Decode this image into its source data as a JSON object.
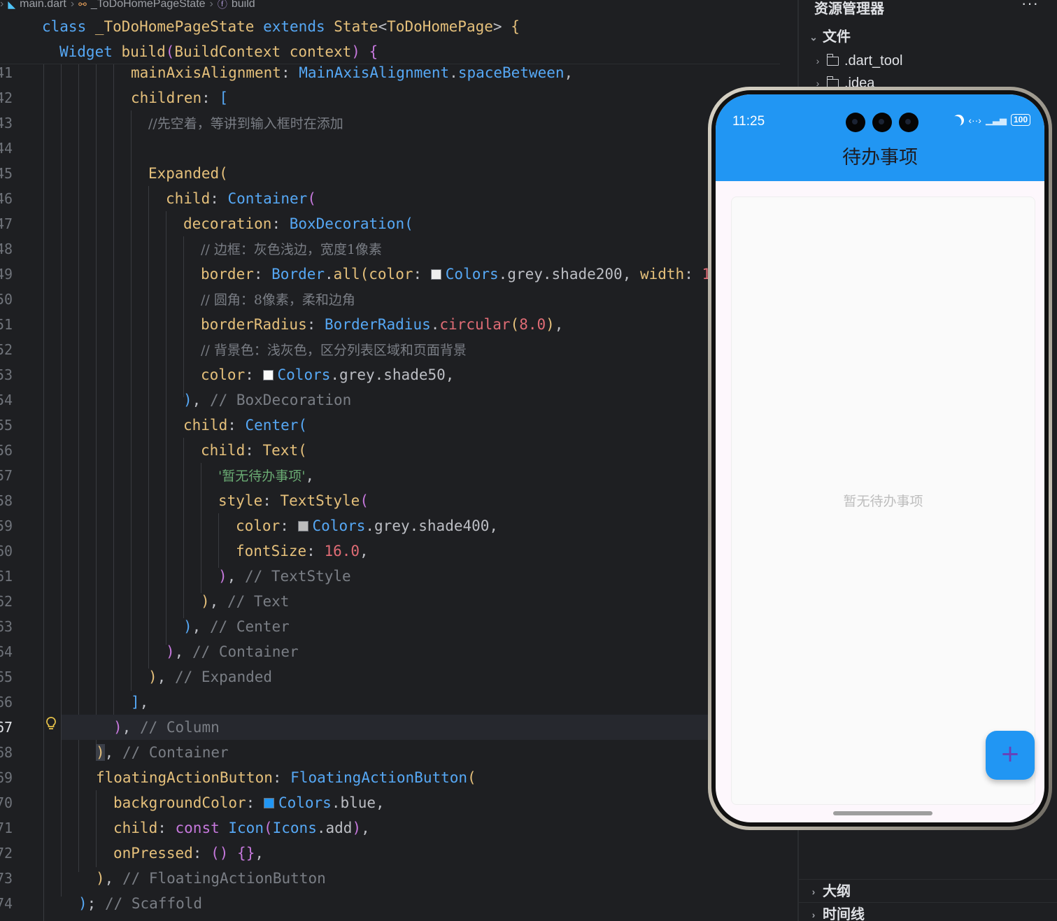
{
  "breadcrumb": {
    "file": "main.dart",
    "class": "_ToDoHomePageState",
    "method": "build"
  },
  "sticky": [
    {
      "kw": "class",
      "name": "_ToDoHomePageState",
      "ext": "extends",
      "base": "State",
      "generic": "ToDoHomePage",
      "brace": "{"
    },
    {
      "ret": "Widget",
      "fn": "build",
      "ptype": "BuildContext",
      "pname": "context",
      "brace": "{"
    }
  ],
  "line_numbers": [
    "41",
    "42",
    "43",
    "44",
    "45",
    "46",
    "47",
    "48",
    "49",
    "50",
    "51",
    "52",
    "53",
    "54",
    "55",
    "56",
    "57",
    "58",
    "59",
    "60",
    "61",
    "62",
    "63",
    "64",
    "65",
    "66",
    "67",
    "68",
    "69",
    "70",
    "71",
    "72",
    "73",
    "74"
  ],
  "code": {
    "l41": {
      "prop": "mainAxisAlignment",
      "ty": "MainAxisAlignment",
      "val": "spaceBetween"
    },
    "l42": {
      "prop": "children",
      "open": "["
    },
    "l43": {
      "comment": "//先空着，等讲到输入框时在添加"
    },
    "l45": {
      "ty": "Expanded",
      "open": "("
    },
    "l46": {
      "prop": "child",
      "ty": "Container",
      "open": "("
    },
    "l47": {
      "prop": "decoration",
      "ty": "BoxDecoration",
      "open": "("
    },
    "l48": {
      "comment": "// 边框：灰色浅边，宽度1像素"
    },
    "l49": {
      "prop": "border",
      "ty": "Border",
      "fn": "all",
      "arg": "color",
      "swatch": "#eeeeee",
      "colors": "Colors",
      "grey": "grey",
      "shade": "shade200",
      "arg2": "width",
      "tail": "1"
    },
    "l50": {
      "comment": "// 圆角：8像素，柔和边角"
    },
    "l51": {
      "prop": "borderRadius",
      "ty": "BorderRadius",
      "fn": "circular",
      "num": "8.0"
    },
    "l52": {
      "comment": "// 背景色：浅灰色，区分列表区域和页面背景"
    },
    "l53": {
      "prop": "color",
      "swatch": "#fafafa",
      "colors": "Colors",
      "grey": "grey",
      "shade": "shade50"
    },
    "l54": {
      "comment": "// BoxDecoration"
    },
    "l55": {
      "prop": "child",
      "ty": "Center",
      "open": "("
    },
    "l56": {
      "prop": "child",
      "ty": "Text",
      "open": "("
    },
    "l57": {
      "str": "'暂无待办事项'"
    },
    "l58": {
      "prop": "style",
      "ty": "TextStyle",
      "open": "("
    },
    "l59": {
      "prop": "color",
      "swatch": "#bdbdbd",
      "colors": "Colors",
      "grey": "grey",
      "shade": "shade400"
    },
    "l60": {
      "prop": "fontSize",
      "num": "16.0"
    },
    "l61": {
      "comment": "// TextStyle"
    },
    "l62": {
      "comment": "// Text"
    },
    "l63": {
      "comment": "// Center"
    },
    "l64": {
      "comment": "// Container"
    },
    "l65": {
      "comment": "// Expanded"
    },
    "l67": {
      "comment": "// Column"
    },
    "l68": {
      "comment": "// Container"
    },
    "l69": {
      "prop": "floatingActionButton",
      "ty": "FloatingActionButton",
      "open": "("
    },
    "l70": {
      "prop": "backgroundColor",
      "swatch": "#2196f3",
      "colors": "Colors",
      "val": "blue"
    },
    "l71": {
      "prop": "child",
      "kw": "const",
      "ty": "Icon",
      "ty2": "Icons",
      "val": "add"
    },
    "l72": {
      "prop": "onPressed"
    },
    "l73": {
      "comment": "// FloatingActionButton"
    },
    "l74": {
      "comment": "// Scaffold"
    }
  },
  "explorer": {
    "title": "资源管理器",
    "more": "···",
    "section_files": "文件",
    "items": [
      ".dart_tool",
      ".idea"
    ],
    "outline": "大纲",
    "timeline": "时间线"
  },
  "phone": {
    "time": "11:25",
    "battery": "100",
    "app_title": "待办事项",
    "empty_text": "暂无待办事项",
    "fab_icon": "+",
    "colors": {
      "appbar": "#2196f3",
      "fab": "#2196f3",
      "background": "#fdf7fc"
    }
  }
}
